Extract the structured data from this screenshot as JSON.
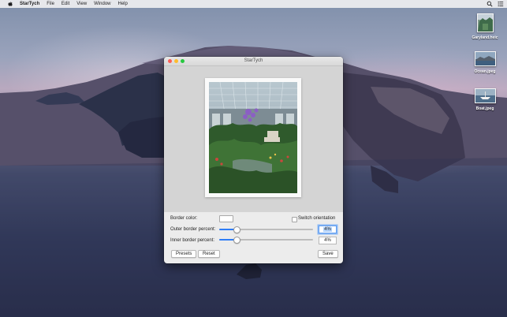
{
  "menubar": {
    "app_name": "StarTych",
    "items": [
      "File",
      "Edit",
      "View",
      "Window",
      "Help"
    ]
  },
  "desktop_icons": [
    {
      "label": "Garyland.heic",
      "icon": "image-file-icon"
    },
    {
      "label": "Ocean.jpeg",
      "icon": "image-file-icon"
    },
    {
      "label": "Boat.jpeg",
      "icon": "image-file-icon"
    }
  ],
  "window": {
    "title": "StarTych",
    "border_color_label": "Border color:",
    "border_color_value": "#ffffff",
    "switch_orientation_label": "Switch orientation",
    "switch_orientation_checked": false,
    "outer_border_label": "Outer border percent:",
    "outer_border_value": "4%",
    "outer_border_level": 0.18,
    "inner_border_label": "Inner border percent:",
    "inner_border_value": "4%",
    "inner_border_level": 0.18,
    "presets_label": "Presets",
    "reset_label": "Reset",
    "save_label": "Save"
  },
  "colors": {
    "accent": "#2e7df6",
    "close": "#fd5f57",
    "minimize": "#febc2e",
    "maximize": "#28c840"
  }
}
